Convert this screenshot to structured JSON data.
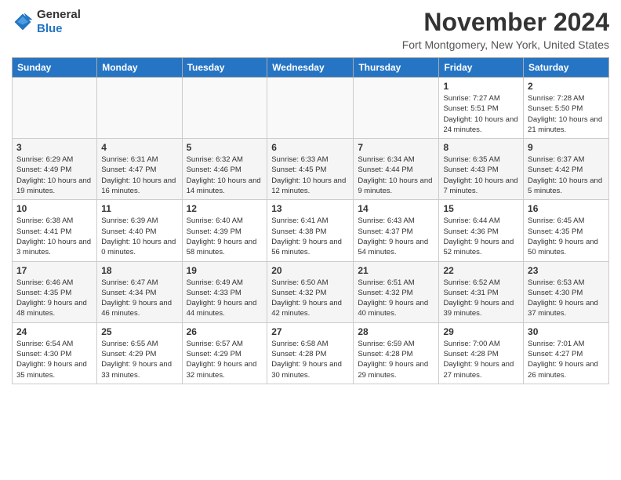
{
  "header": {
    "logo": {
      "general": "General",
      "blue": "Blue"
    },
    "title": "November 2024",
    "location": "Fort Montgomery, New York, United States"
  },
  "columns": [
    "Sunday",
    "Monday",
    "Tuesday",
    "Wednesday",
    "Thursday",
    "Friday",
    "Saturday"
  ],
  "weeks": [
    [
      {
        "day": "",
        "info": ""
      },
      {
        "day": "",
        "info": ""
      },
      {
        "day": "",
        "info": ""
      },
      {
        "day": "",
        "info": ""
      },
      {
        "day": "",
        "info": ""
      },
      {
        "day": "1",
        "info": "Sunrise: 7:27 AM\nSunset: 5:51 PM\nDaylight: 10 hours and 24 minutes."
      },
      {
        "day": "2",
        "info": "Sunrise: 7:28 AM\nSunset: 5:50 PM\nDaylight: 10 hours and 21 minutes."
      }
    ],
    [
      {
        "day": "3",
        "info": "Sunrise: 6:29 AM\nSunset: 4:49 PM\nDaylight: 10 hours and 19 minutes."
      },
      {
        "day": "4",
        "info": "Sunrise: 6:31 AM\nSunset: 4:47 PM\nDaylight: 10 hours and 16 minutes."
      },
      {
        "day": "5",
        "info": "Sunrise: 6:32 AM\nSunset: 4:46 PM\nDaylight: 10 hours and 14 minutes."
      },
      {
        "day": "6",
        "info": "Sunrise: 6:33 AM\nSunset: 4:45 PM\nDaylight: 10 hours and 12 minutes."
      },
      {
        "day": "7",
        "info": "Sunrise: 6:34 AM\nSunset: 4:44 PM\nDaylight: 10 hours and 9 minutes."
      },
      {
        "day": "8",
        "info": "Sunrise: 6:35 AM\nSunset: 4:43 PM\nDaylight: 10 hours and 7 minutes."
      },
      {
        "day": "9",
        "info": "Sunrise: 6:37 AM\nSunset: 4:42 PM\nDaylight: 10 hours and 5 minutes."
      }
    ],
    [
      {
        "day": "10",
        "info": "Sunrise: 6:38 AM\nSunset: 4:41 PM\nDaylight: 10 hours and 3 minutes."
      },
      {
        "day": "11",
        "info": "Sunrise: 6:39 AM\nSunset: 4:40 PM\nDaylight: 10 hours and 0 minutes."
      },
      {
        "day": "12",
        "info": "Sunrise: 6:40 AM\nSunset: 4:39 PM\nDaylight: 9 hours and 58 minutes."
      },
      {
        "day": "13",
        "info": "Sunrise: 6:41 AM\nSunset: 4:38 PM\nDaylight: 9 hours and 56 minutes."
      },
      {
        "day": "14",
        "info": "Sunrise: 6:43 AM\nSunset: 4:37 PM\nDaylight: 9 hours and 54 minutes."
      },
      {
        "day": "15",
        "info": "Sunrise: 6:44 AM\nSunset: 4:36 PM\nDaylight: 9 hours and 52 minutes."
      },
      {
        "day": "16",
        "info": "Sunrise: 6:45 AM\nSunset: 4:35 PM\nDaylight: 9 hours and 50 minutes."
      }
    ],
    [
      {
        "day": "17",
        "info": "Sunrise: 6:46 AM\nSunset: 4:35 PM\nDaylight: 9 hours and 48 minutes."
      },
      {
        "day": "18",
        "info": "Sunrise: 6:47 AM\nSunset: 4:34 PM\nDaylight: 9 hours and 46 minutes."
      },
      {
        "day": "19",
        "info": "Sunrise: 6:49 AM\nSunset: 4:33 PM\nDaylight: 9 hours and 44 minutes."
      },
      {
        "day": "20",
        "info": "Sunrise: 6:50 AM\nSunset: 4:32 PM\nDaylight: 9 hours and 42 minutes."
      },
      {
        "day": "21",
        "info": "Sunrise: 6:51 AM\nSunset: 4:32 PM\nDaylight: 9 hours and 40 minutes."
      },
      {
        "day": "22",
        "info": "Sunrise: 6:52 AM\nSunset: 4:31 PM\nDaylight: 9 hours and 39 minutes."
      },
      {
        "day": "23",
        "info": "Sunrise: 6:53 AM\nSunset: 4:30 PM\nDaylight: 9 hours and 37 minutes."
      }
    ],
    [
      {
        "day": "24",
        "info": "Sunrise: 6:54 AM\nSunset: 4:30 PM\nDaylight: 9 hours and 35 minutes."
      },
      {
        "day": "25",
        "info": "Sunrise: 6:55 AM\nSunset: 4:29 PM\nDaylight: 9 hours and 33 minutes."
      },
      {
        "day": "26",
        "info": "Sunrise: 6:57 AM\nSunset: 4:29 PM\nDaylight: 9 hours and 32 minutes."
      },
      {
        "day": "27",
        "info": "Sunrise: 6:58 AM\nSunset: 4:28 PM\nDaylight: 9 hours and 30 minutes."
      },
      {
        "day": "28",
        "info": "Sunrise: 6:59 AM\nSunset: 4:28 PM\nDaylight: 9 hours and 29 minutes."
      },
      {
        "day": "29",
        "info": "Sunrise: 7:00 AM\nSunset: 4:28 PM\nDaylight: 9 hours and 27 minutes."
      },
      {
        "day": "30",
        "info": "Sunrise: 7:01 AM\nSunset: 4:27 PM\nDaylight: 9 hours and 26 minutes."
      }
    ]
  ]
}
